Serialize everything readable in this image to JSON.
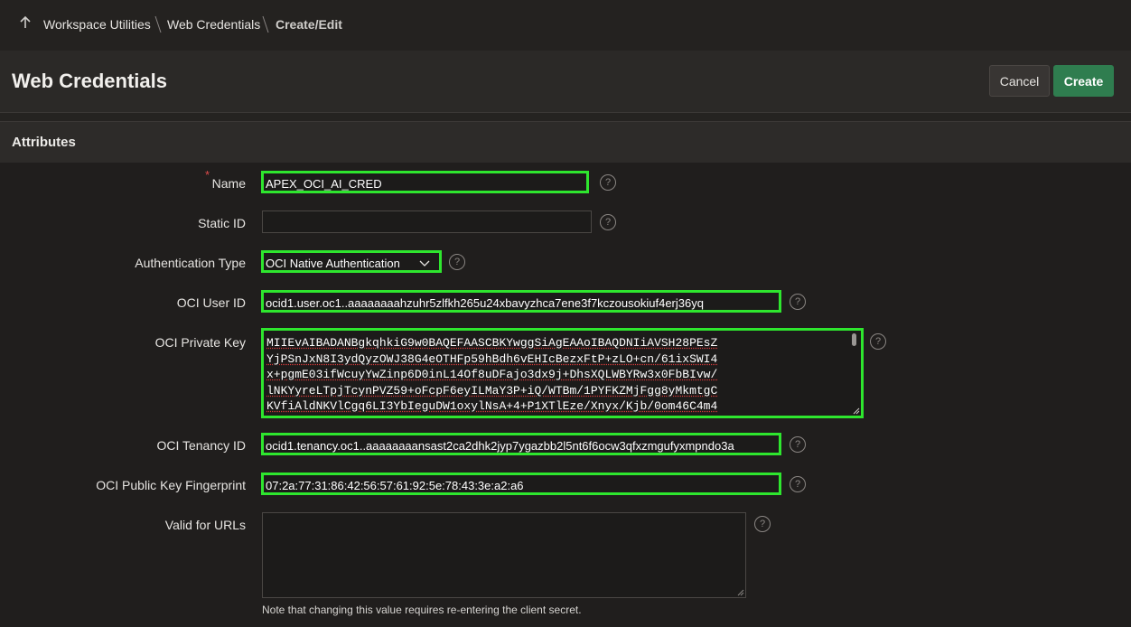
{
  "breadcrumb": {
    "items": [
      "Workspace Utilities",
      "Web Credentials"
    ],
    "current": "Create/Edit"
  },
  "header": {
    "title": "Web Credentials",
    "cancel_label": "Cancel",
    "create_label": "Create"
  },
  "region": {
    "title": "Attributes"
  },
  "form": {
    "name": {
      "label": "Name",
      "required_marker": "*",
      "value": "APEX_OCI_AI_CRED"
    },
    "static_id": {
      "label": "Static ID",
      "value": ""
    },
    "auth_type": {
      "label": "Authentication Type",
      "value": "OCI Native Authentication"
    },
    "oci_user_id": {
      "label": "OCI User ID",
      "value": "ocid1.user.oc1..aaaaaaaahzuhr5zlfkh265u24xbavyzhca7ene3f7kczousokiuf4erj36yq"
    },
    "oci_private_key": {
      "label": "OCI Private Key",
      "lines": [
        "MIIEvAIBADANBgkqhkiG9w0BAQEFAASCBKYwggSiAgEAAoIBAQDNIiAVSH28PEsZ",
        "YjPSnJxN8I3ydQyzOWJ38G4eOTHFp59hBdh6vEHIcBezxFtP+zLO+cn/61ixSWI4",
        "x+pgmE03ifWcuyYwZinp6D0inL14Of8uDFajo3dx9j+DhsXQLWBYRw3x0FbBIvw/",
        "lNKYyreLTpjTcynPVZ59+oFcpF6eyILMaY3P+iQ/WTBm/1PYFKZMjFgg8yMkmtgC",
        "KVfiAldNKVlCgq6LI3YbIeguDW1oxylNsA+4+P1XTlEze/Xnyx/Kjb/0om46C4m4"
      ]
    },
    "oci_tenancy_id": {
      "label": "OCI Tenancy ID",
      "value": "ocid1.tenancy.oc1..aaaaaaaansast2ca2dhk2jyp7ygazbb2l5nt6f6ocw3qfxzmgufyxmpndo3a"
    },
    "oci_fingerprint": {
      "label": "OCI Public Key Fingerprint",
      "value": "07:2a:77:31:86:42:56:57:61:92:5e:78:43:3e:a2:a6"
    },
    "valid_urls": {
      "label": "Valid for URLs",
      "value": "",
      "note": "Note that changing this value requires re-entering the client secret."
    }
  },
  "help_glyph": "?",
  "colors": {
    "highlight": "#2ee62e",
    "create_button": "#2f7d4f",
    "required": "#e04b4b"
  }
}
